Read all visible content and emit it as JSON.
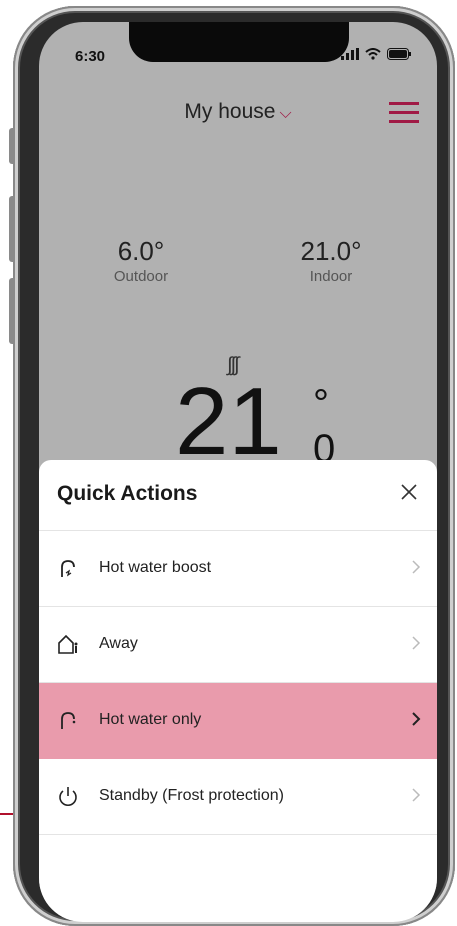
{
  "status": {
    "time": "6:30"
  },
  "header": {
    "title": "My house",
    "chevron": "⌵"
  },
  "readings": {
    "outdoor": {
      "value": "6.0°",
      "label": "Outdoor"
    },
    "indoor": {
      "value": "21.0°",
      "label": "Indoor"
    }
  },
  "thermostat": {
    "heating_glyph": "∫∫∫",
    "temperature": "21",
    "degree": "°",
    "decimal": "0"
  },
  "quick_actions": {
    "title": "Quick Actions",
    "items": [
      {
        "label": "Hot water boost",
        "icon": "tap-boost-icon",
        "active": false
      },
      {
        "label": "Away",
        "icon": "house-person-icon",
        "active": false
      },
      {
        "label": "Hot water only",
        "icon": "tap-icon",
        "active": true
      },
      {
        "label": "Standby (Frost protection)",
        "icon": "power-icon",
        "active": false
      }
    ]
  },
  "colors": {
    "accent": "#a01a45",
    "highlight": "#e99bac",
    "background_dim": "#b1b1b1"
  }
}
